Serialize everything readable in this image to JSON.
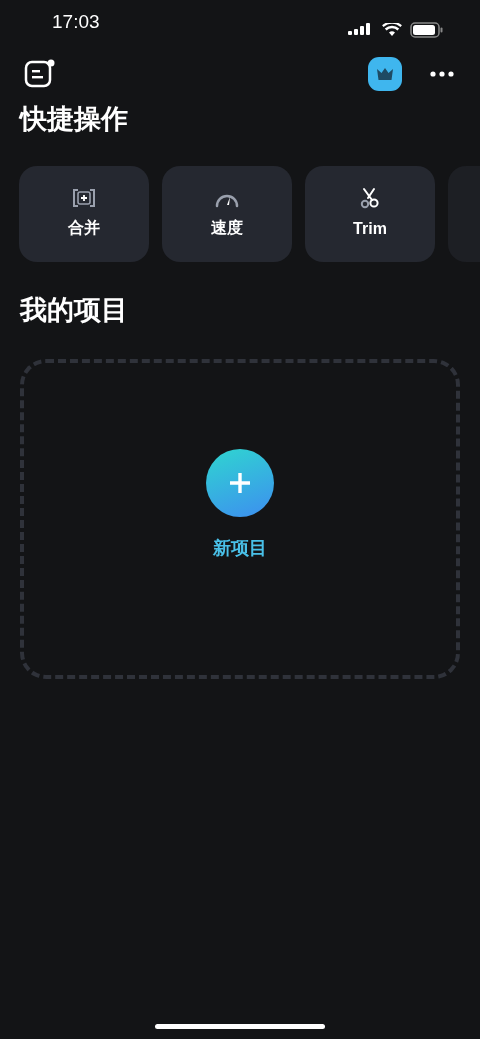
{
  "status_bar": {
    "time": "17:03"
  },
  "quick_actions": {
    "title": "快捷操作",
    "items": [
      {
        "kind": "merge",
        "label": "合并"
      },
      {
        "kind": "speed",
        "label": "速度"
      },
      {
        "kind": "trim",
        "label": "Trim"
      }
    ]
  },
  "projects": {
    "title": "我的项目",
    "new_project": {
      "label": "新项目"
    }
  }
}
